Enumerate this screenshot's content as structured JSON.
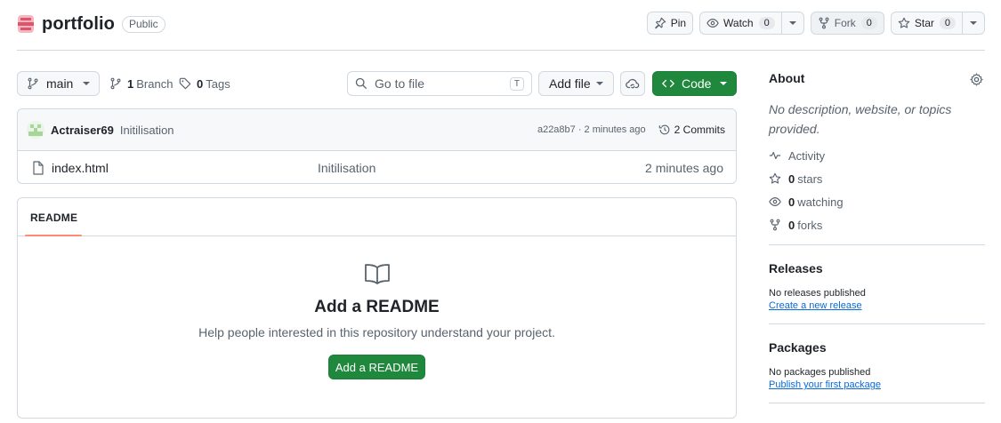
{
  "repo": {
    "name": "portfolio",
    "visibility": "Public"
  },
  "header_actions": {
    "pin_label": "Pin",
    "watch_label": "Watch",
    "watch_count": "0",
    "fork_label": "Fork",
    "fork_count": "0",
    "star_label": "Star",
    "star_count": "0"
  },
  "toolbar": {
    "branch": "main",
    "branch_count": "1",
    "branch_label": "Branch",
    "tag_count": "0",
    "tag_label": "Tags",
    "search_placeholder": "Go to file",
    "search_shortcut": "T",
    "add_file_label": "Add file",
    "code_label": "Code"
  },
  "latest_commit": {
    "author": "Actraiser69",
    "message": "Initilisation",
    "hash_time": "a22a8b7 · 2 minutes ago",
    "commits_label": "2 Commits"
  },
  "files": [
    {
      "name": "index.html",
      "message": "Initilisation",
      "age": "2 minutes ago"
    }
  ],
  "readme": {
    "tab_label": "README",
    "title": "Add a README",
    "subtitle": "Help people interested in this repository understand your project.",
    "button_label": "Add a README"
  },
  "sidebar": {
    "about_title": "About",
    "about_desc": "No description, website, or topics provided.",
    "activity_label": "Activity",
    "stars_count": "0",
    "stars_label": "stars",
    "watching_count": "0",
    "watching_label": "watching",
    "forks_count": "0",
    "forks_label": "forks",
    "releases_title": "Releases",
    "releases_empty": "No releases published",
    "releases_link": "Create a new release",
    "packages_title": "Packages",
    "packages_empty": "No packages published",
    "packages_link": "Publish your first package"
  },
  "colors": {
    "primary_green": "#1f883d",
    "tab_accent": "#fd8c73",
    "link_blue": "#0969da"
  }
}
